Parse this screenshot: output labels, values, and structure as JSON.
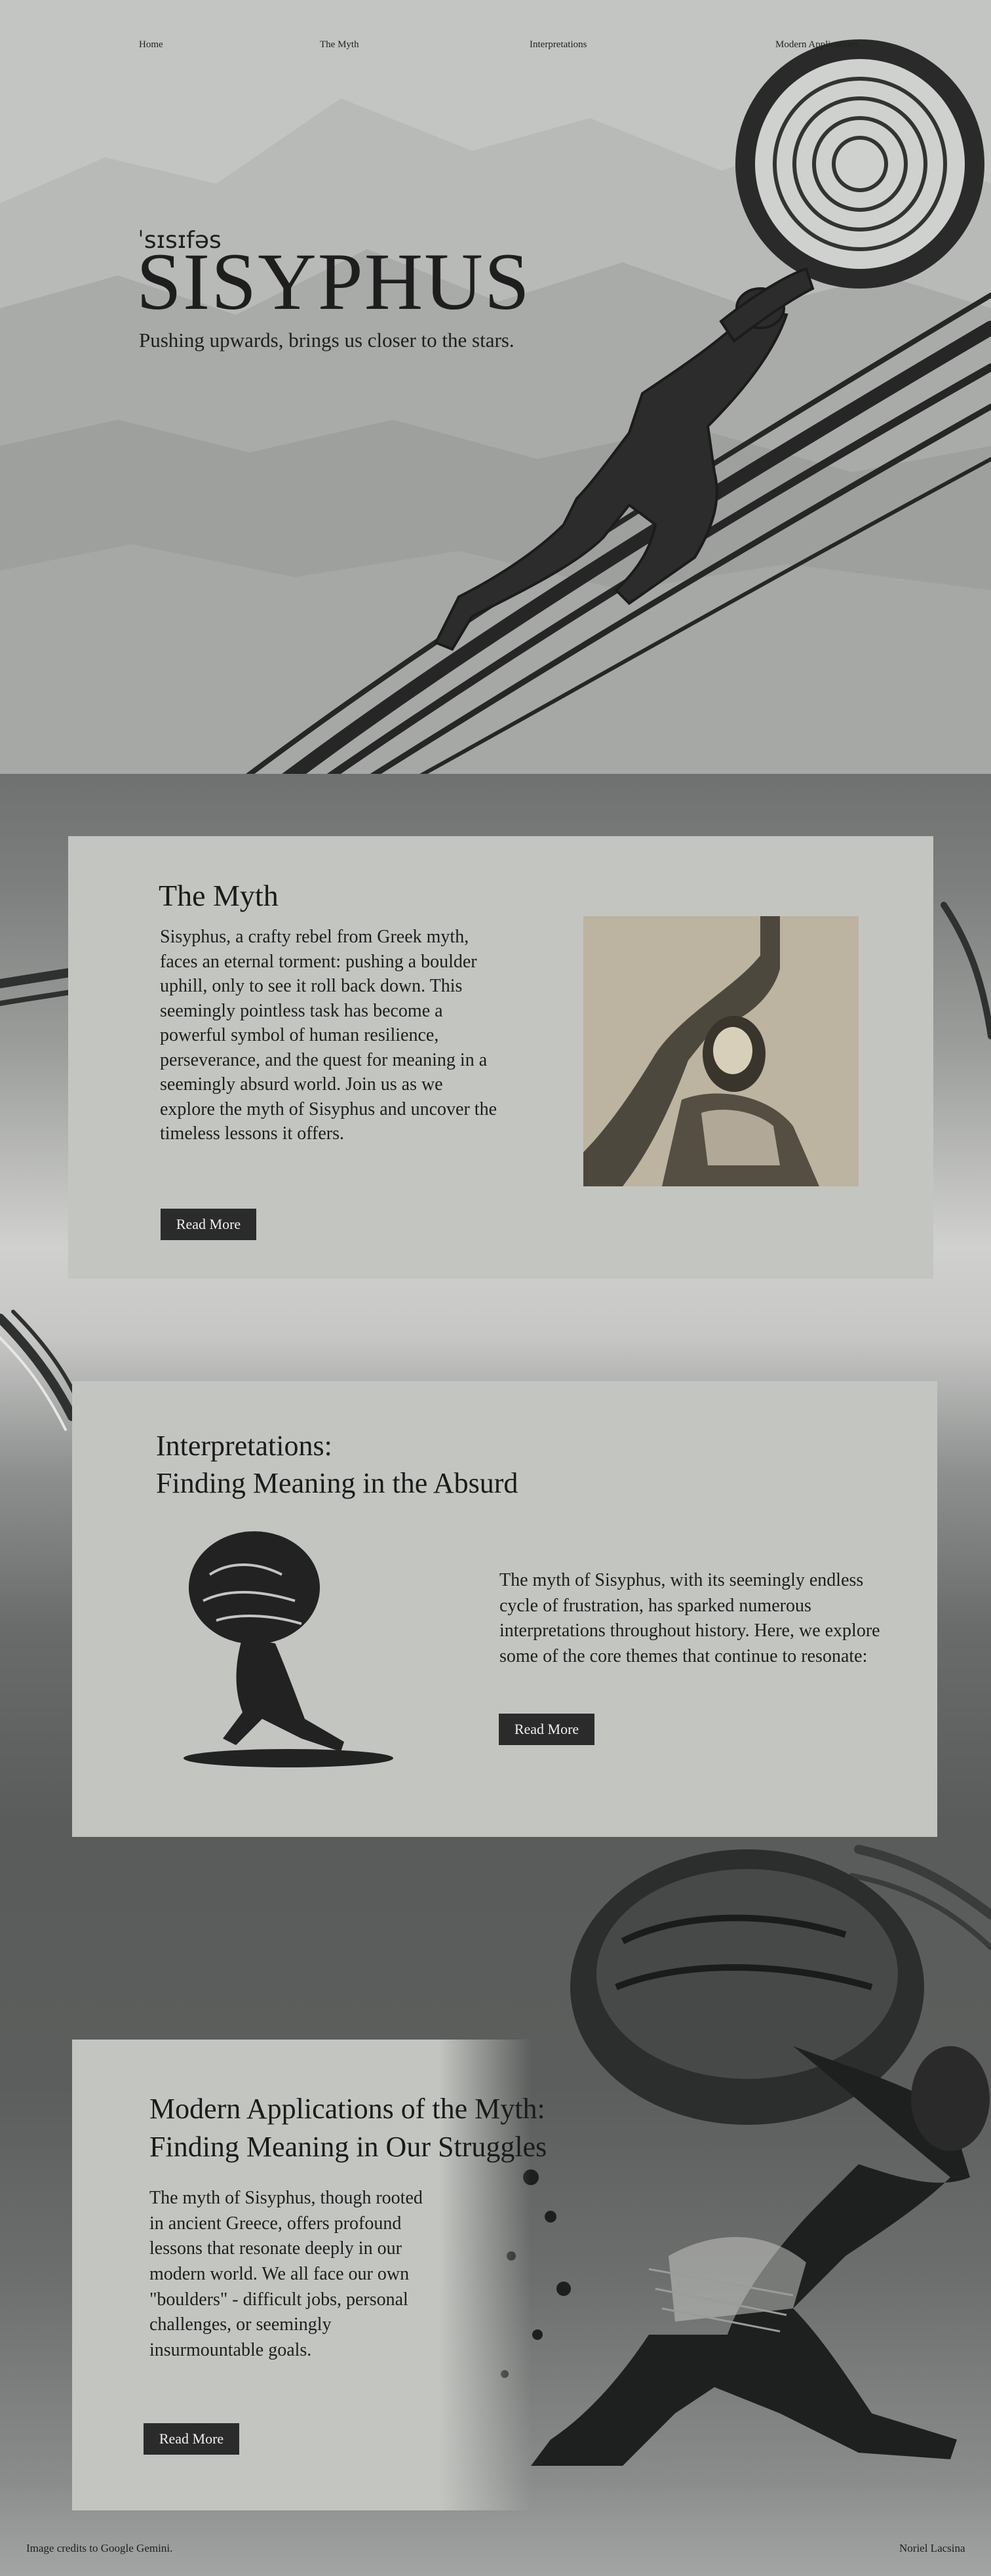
{
  "nav": {
    "home": "Home",
    "myth": "The Myth",
    "interpretations": "Interpretations",
    "modern": "Modern Applications"
  },
  "hero": {
    "phonetic": "ˈsɪsɪfəs",
    "title": "SISYPHUS",
    "tagline": "Pushing upwards, brings us closer to the stars."
  },
  "myth": {
    "heading": "The Myth",
    "text": "Sisyphus, a crafty rebel from Greek myth, faces an eternal torment: pushing a boulder uphill, only to see it roll back down. This seemingly pointless task has become a powerful symbol of human resilience, perseverance, and the quest for meaning in a seemingly absurd world. Join us as we explore the myth of Sisyphus and uncover the timeless lessons it offers.",
    "button": "Read More"
  },
  "interpretations": {
    "heading_line1": "Interpretations:",
    "heading_line2": "Finding Meaning in the Absurd",
    "text": "The myth of Sisyphus, with its seemingly endless cycle of frustration, has sparked numerous interpretations throughout history. Here, we explore some of the core themes that continue to resonate:",
    "button": "Read More"
  },
  "modern": {
    "heading_line1": "Modern Applications of the Myth:",
    "heading_line2": "Finding Meaning in Our Struggles",
    "text": "The myth of Sisyphus, though rooted in ancient Greece, offers profound lessons that resonate deeply in our modern world.  We all face our own \"boulders\" -  difficult jobs, personal challenges, or seemingly insurmountable goals.",
    "button": "Read More"
  },
  "footer": {
    "credit": "Image credits to Google Gemini.",
    "author": "Noriel Lacsina"
  },
  "colors": {
    "background": "#c2c4c1",
    "card": "#c3c5c1",
    "button": "#2b2b2b",
    "ink": "#1e1e1e"
  }
}
